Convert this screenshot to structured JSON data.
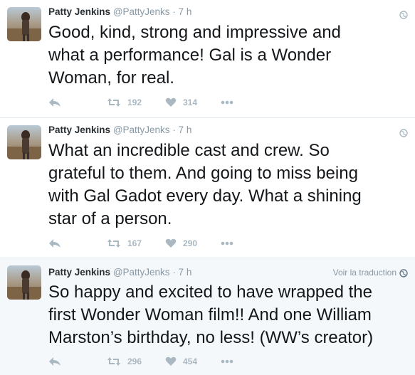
{
  "tweets": [
    {
      "name": "Patty Jenkins",
      "handle": "@PattyJenks",
      "time": "· 7 h",
      "text": "Good, kind, strong and impressive and\nwhat a performance!  Gal is a Wonder\nWoman, for real.",
      "retweets": "192",
      "likes": "314",
      "icon": "globe-icon"
    },
    {
      "name": "Patty Jenkins",
      "handle": "@PattyJenks",
      "time": "· 7 h",
      "text": "What an incredible cast and crew. So\ngrateful to them. And going to miss being\nwith Gal Gadot every day. What a shining\nstar of a person.",
      "retweets": "167",
      "likes": "290",
      "icon": "globe-icon"
    },
    {
      "name": "Patty Jenkins",
      "handle": "@PattyJenks",
      "time": "· 7 h",
      "translate": "Voir la traduction",
      "text": "So happy and excited to have wrapped the\nfirst Wonder Woman film!! And one William\nMarston’s birthday, no less! (WW’s creator)",
      "retweets": "296",
      "likes": "454",
      "icon": "globe-icon"
    }
  ],
  "colors": {
    "icon": "#aab8c2",
    "muted": "#8899a6",
    "text": "#14171a",
    "highlight_bg": "#f5f8fa",
    "divider": "#e1e8ed"
  }
}
